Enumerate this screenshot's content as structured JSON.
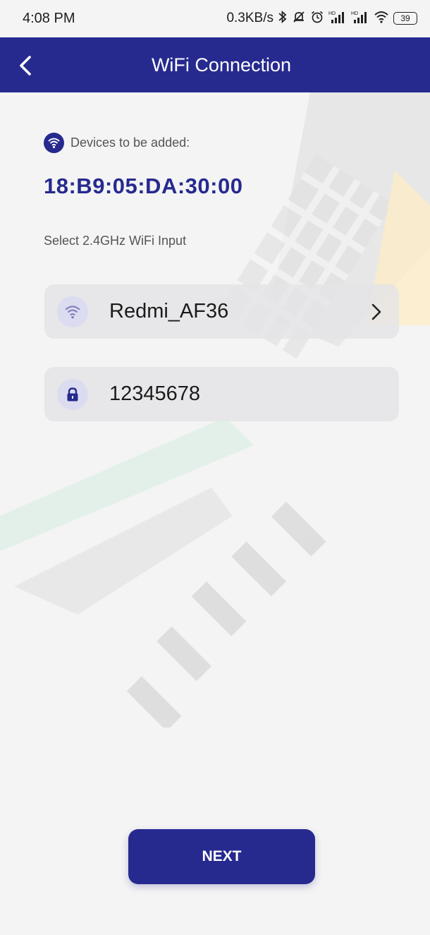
{
  "status_bar": {
    "time": "4:08 PM",
    "network_speed": "0.3KB/s",
    "icons": [
      "bluetooth-icon",
      "mute-icon",
      "alarm-icon",
      "hd-signal-icon",
      "hd-signal-icon",
      "wifi-icon"
    ],
    "battery": "39"
  },
  "header": {
    "title": "WiFi Connection",
    "back_icon": "chevron-left-icon"
  },
  "device": {
    "label": "Devices to be added:",
    "icon": "wifi-icon",
    "mac": "18:B9:05:DA:30:00"
  },
  "wifi_section": {
    "label": "Select 2.4GHz WiFi Input",
    "ssid": "Redmi_AF36",
    "ssid_icon": "wifi-icon",
    "password": "12345678",
    "password_icon": "lock-icon"
  },
  "actions": {
    "next_label": "NEXT"
  },
  "colors": {
    "primary": "#262a8f",
    "background": "#f4f4f4",
    "field_background": "#e4e4e6"
  }
}
